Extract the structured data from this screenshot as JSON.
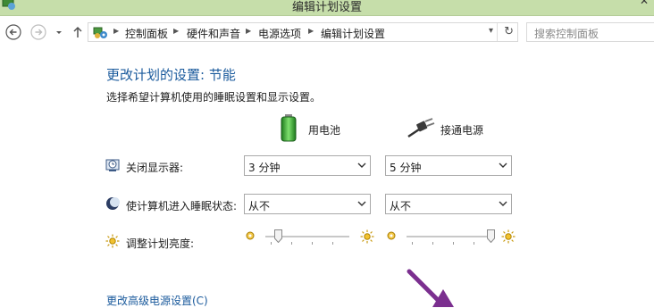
{
  "window": {
    "title": "编辑计划设置"
  },
  "nav": {
    "breadcrumbs": [
      "控制面板",
      "硬件和声音",
      "电源选项",
      "编辑计划设置"
    ],
    "search_placeholder": "搜索控制面板"
  },
  "main": {
    "heading": "更改计划的设置: 节能",
    "subheading": "选择希望计算机使用的睡眠设置和显示设置。",
    "columns": {
      "battery": "用电池",
      "plugged": "接通电源"
    },
    "rows": [
      {
        "label": "关闭显示器:",
        "battery": "3 分钟",
        "plugged": "5 分钟"
      },
      {
        "label": "使计算机进入睡眠状态:",
        "battery": "从不",
        "plugged": "从不"
      },
      {
        "label": "调整计划亮度:",
        "battery_level": 0.15,
        "plugged_level": 1.0
      }
    ],
    "advanced_link": "更改高级电源设置(C)"
  },
  "colors": {
    "accent": "#1a5a9c",
    "titlebar": "#c6deaa"
  }
}
